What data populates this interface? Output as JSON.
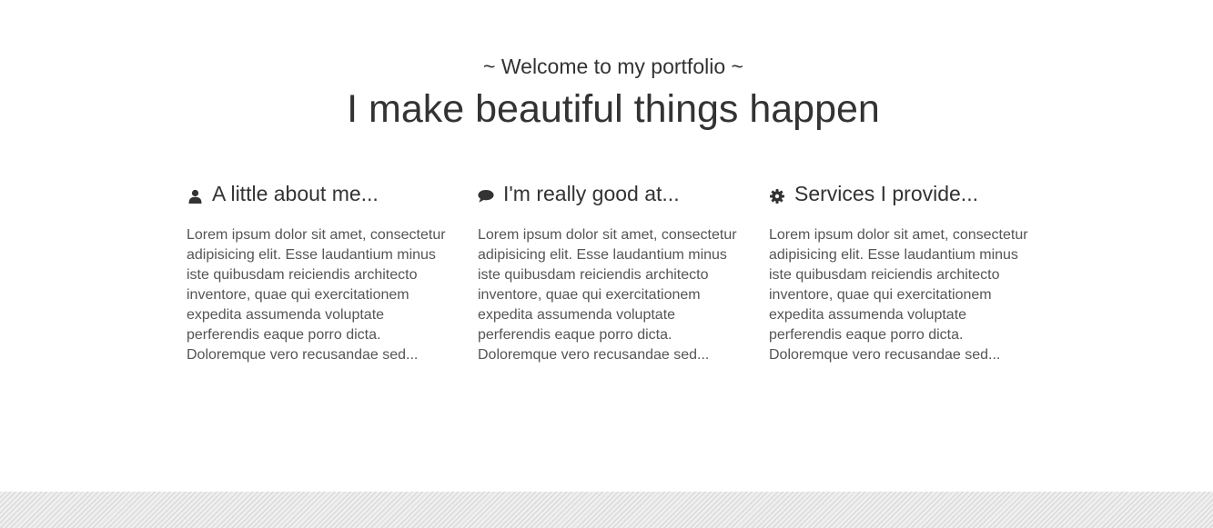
{
  "hero": {
    "welcome": "~ Welcome to my portfolio ~",
    "tagline": "I make beautiful things happen"
  },
  "features": [
    {
      "icon": "user-icon",
      "title": "A little about me...",
      "text": "Lorem ipsum dolor sit amet, consectetur adipisicing elit. Esse laudantium minus iste quibusdam reiciendis architecto inventore, quae qui exercitationem expedita assumenda voluptate perferendis eaque porro dicta. Doloremque vero recusandae sed..."
    },
    {
      "icon": "comment-icon",
      "title": "I'm really good at...",
      "text": "Lorem ipsum dolor sit amet, consectetur adipisicing elit. Esse laudantium minus iste quibusdam reiciendis architecto inventore, quae qui exercitationem expedita assumenda voluptate perferendis eaque porro dicta. Doloremque vero recusandae sed..."
    },
    {
      "icon": "gear-icon",
      "title": "Services I provide...",
      "text": "Lorem ipsum dolor sit amet, consectetur adipisicing elit. Esse laudantium minus iste quibusdam reiciendis architecto inventore, quae qui exercitationem expedita assumenda voluptate perferendis eaque porro dicta. Doloremque vero recusandae sed..."
    }
  ],
  "colors": {
    "text": "#333333",
    "body_text": "#555555",
    "footer_stripe": "#d4d4d4"
  }
}
